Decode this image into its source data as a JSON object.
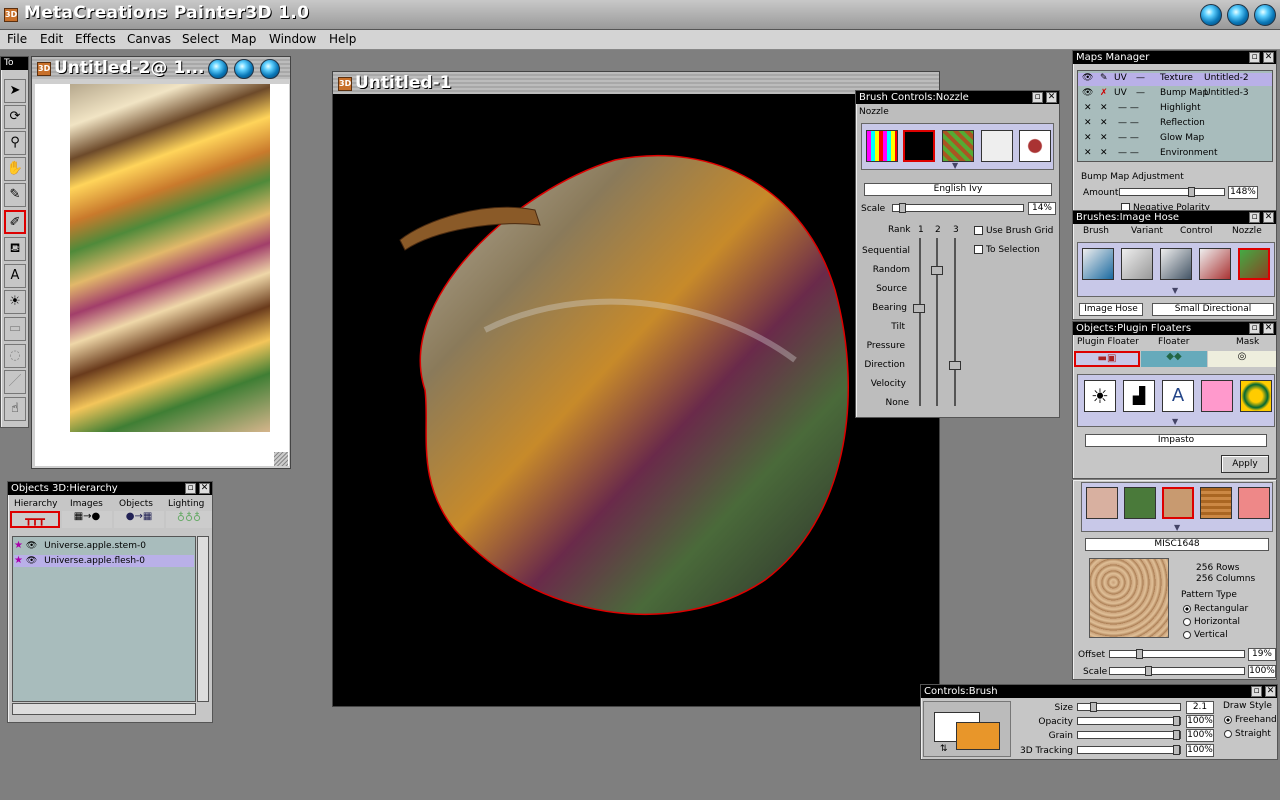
{
  "app": {
    "title": "MetaCreations Painter3D 1.0"
  },
  "menu": [
    "File",
    "Edit",
    "Effects",
    "Canvas",
    "Select",
    "Map",
    "Window",
    "Help"
  ],
  "toolbox": {
    "label": "To"
  },
  "doc2": {
    "title": "Untitled-2@ 1..."
  },
  "doc1": {
    "title": "Untitled-1"
  },
  "hierarchy": {
    "title": "Objects 3D:Hierarchy",
    "tabs": [
      "Hierarchy",
      "Images",
      "Objects",
      "Lighting"
    ],
    "items": [
      "Universe.apple.stem-0",
      "Universe.apple.flesh-0"
    ]
  },
  "brush_nozzle": {
    "title": "Brush Controls:Nozzle",
    "section": "Nozzle",
    "nozzle_name": "English Ivy",
    "scale_label": "Scale",
    "scale_value": "14%",
    "rank_label": "Rank",
    "rank_cols": [
      "1",
      "2",
      "3"
    ],
    "rows": [
      "Sequential",
      "Random",
      "Source",
      "Bearing",
      "Tilt",
      "Pressure",
      "Direction",
      "Velocity",
      "None"
    ],
    "use_brush_grid": "Use Brush Grid",
    "to_selection": "To Selection"
  },
  "maps": {
    "title": "Maps Manager",
    "rows": [
      {
        "uv": "UV",
        "name": "Texture",
        "file": "Untitled-2"
      },
      {
        "uv": "UV",
        "name": "Bump Map",
        "file": "Untitled-3"
      },
      {
        "uv": "",
        "name": "Highlight",
        "file": ""
      },
      {
        "uv": "",
        "name": "Reflection",
        "file": ""
      },
      {
        "uv": "",
        "name": "Glow Map",
        "file": ""
      },
      {
        "uv": "",
        "name": "Environment",
        "file": ""
      }
    ],
    "adjust_label": "Bump Map Adjustment",
    "amount_label": "Amount",
    "amount_value": "148%",
    "negative": "Negative Polarity"
  },
  "brushes": {
    "title": "Brushes:Image Hose",
    "tabs": [
      "Brush",
      "Variant",
      "Control",
      "Nozzle"
    ],
    "brush_name": "Image Hose",
    "variant_name": "Small Directional"
  },
  "objects": {
    "title": "Objects:Plugin Floaters",
    "tabs": [
      "Plugin Floater",
      "Floater",
      "Mask"
    ],
    "plugin_name": "Impasto",
    "apply": "Apply"
  },
  "pattern": {
    "name": "MISC1648",
    "rows": "256 Rows",
    "cols": "256 Columns",
    "type_label": "Pattern Type",
    "types": [
      "Rectangular",
      "Horizontal",
      "Vertical"
    ],
    "offset_label": "Offset",
    "offset_value": "19%",
    "scale_label": "Scale",
    "scale_value": "100%"
  },
  "controls": {
    "title": "Controls:Brush",
    "size_label": "Size",
    "size_value": "2.1",
    "opacity_label": "Opacity",
    "opacity_value": "100%",
    "grain_label": "Grain",
    "grain_value": "100%",
    "tracking_label": "3D Tracking",
    "tracking_value": "100%",
    "draw_style": "Draw Style",
    "styles": [
      "Freehand",
      "Straight"
    ]
  },
  "colors": {
    "primary": "#ffffff",
    "secondary": "#e8962a",
    "selection": "#b9b0e8"
  }
}
